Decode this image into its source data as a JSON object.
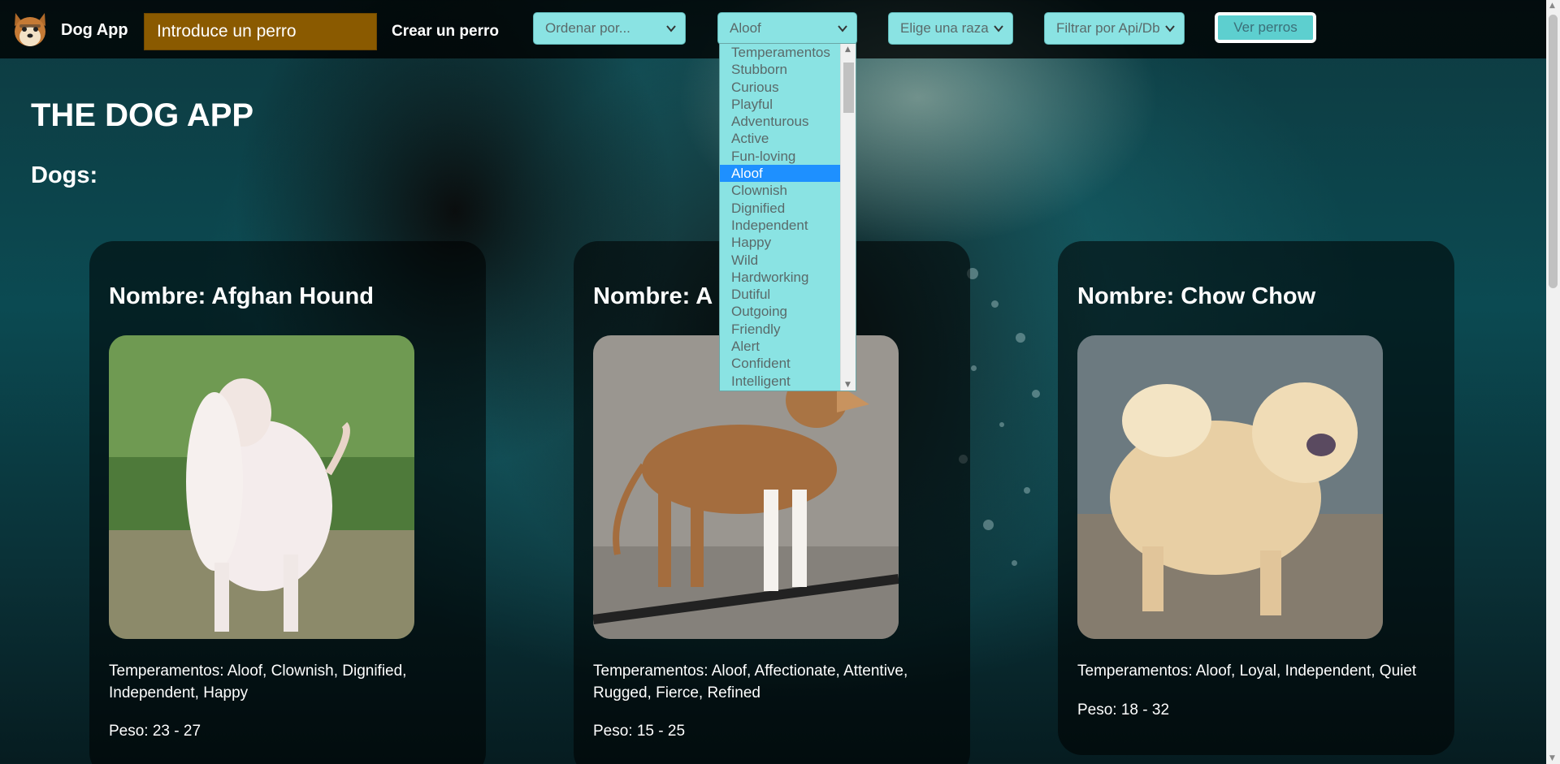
{
  "navbar": {
    "brand": "Dog App",
    "search_placeholder": "Introduce un perro",
    "create_link": "Crear un perro",
    "order_select": "Ordenar por...",
    "temperament_select": "Aloof",
    "breed_select": "Elige una raza",
    "source_select": "Filtrar por Api/Db",
    "view_button": "Ver perros"
  },
  "dropdown": {
    "options": [
      "Temperamentos",
      "Stubborn",
      "Curious",
      "Playful",
      "Adventurous",
      "Active",
      "Fun-loving",
      "Aloof",
      "Clownish",
      "Dignified",
      "Independent",
      "Happy",
      "Wild",
      "Hardworking",
      "Dutiful",
      "Outgoing",
      "Friendly",
      "Alert",
      "Confident",
      "Intelligent"
    ],
    "selected": "Aloof"
  },
  "main": {
    "title": "THE DOG APP",
    "subtitle": "Dogs:"
  },
  "cards": [
    {
      "name": "Nombre: Afghan Hound",
      "temperament": "Temperamentos: Aloof, Clownish, Dignified, Independent, Happy",
      "weight": "Peso: 23 - 27"
    },
    {
      "name": "Nombre: A",
      "temperament": "Temperamentos: Aloof, Affectionate, Attentive, Rugged, Fierce, Refined",
      "weight": "Peso: 15 - 25"
    },
    {
      "name": "Nombre: Chow Chow",
      "temperament": "Temperamentos: Aloof, Loyal, Independent, Quiet",
      "weight": "Peso: 18 - 32"
    }
  ],
  "colors": {
    "accent": "#8ae3e3",
    "search_bg": "#8a5a00",
    "selected_option": "#1e90ff"
  }
}
